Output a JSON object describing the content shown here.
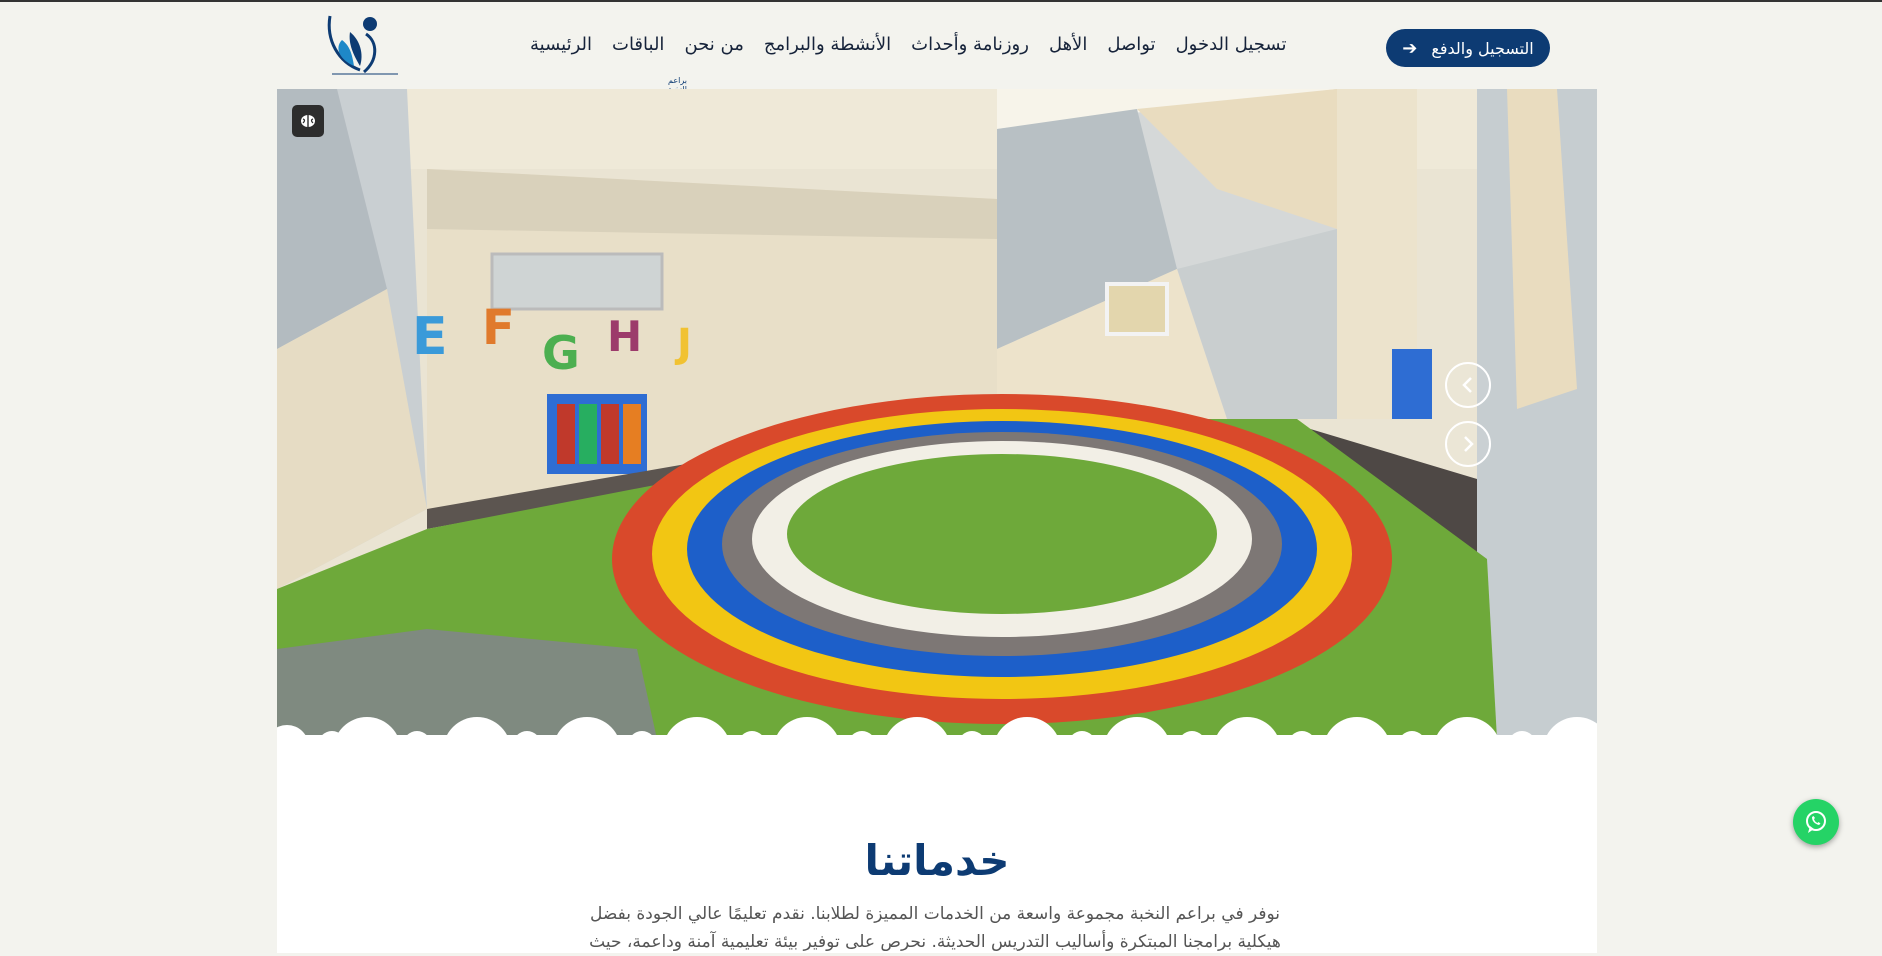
{
  "brand": {
    "logo_text": "براعم النخبة",
    "primary_color": "#0d3b73",
    "whatsapp_color": "#25d366"
  },
  "nav": {
    "items": [
      {
        "label": "الرئيسية"
      },
      {
        "label": "الباقات"
      },
      {
        "label": "من نحن"
      },
      {
        "label": "الأنشطة والبرامج"
      },
      {
        "label": "روزنامة وأحداث"
      },
      {
        "label": "الأهل"
      },
      {
        "label": "تواصل"
      },
      {
        "label": "تسجيل الدخول"
      }
    ]
  },
  "header": {
    "register_label": "التسجيل والدفع",
    "register_icon": "arrow-right-icon"
  },
  "hero": {
    "badge_icon": "brain-icon",
    "prev_icon": "chevron-left-icon",
    "next_icon": "chevron-right-icon"
  },
  "services": {
    "title": "خدماتنا",
    "description": "نوفر في براعم النخبة مجموعة واسعة من الخدمات المميزة لطلابنا. نقدم تعليمًا عالي الجودة بفضل هيكلية برامجنا المبتكرة وأساليب التدريس الحديثة. نحرص على توفير بيئة تعليمية آمنة وداعمة، حيث"
  },
  "floating": {
    "whatsapp_icon": "whatsapp-icon"
  }
}
